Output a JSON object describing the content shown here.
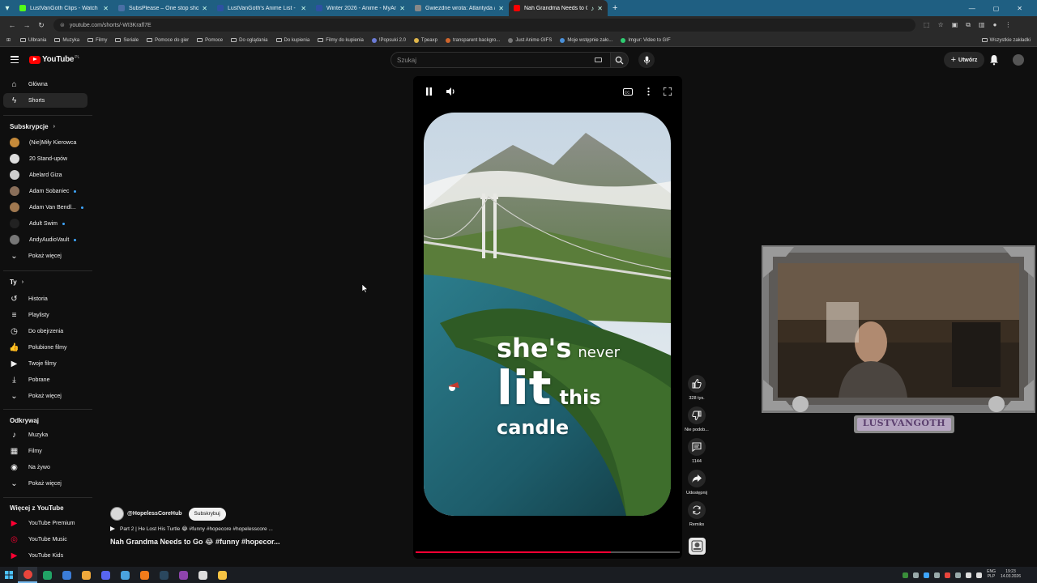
{
  "browser": {
    "tabs": [
      {
        "title": "LustVanGoth Clips - Watch Live",
        "favicon_color": "#53fc18",
        "active": false
      },
      {
        "title": "SubsPlease – One stop shop fo",
        "favicon_color": "#4a6fa5",
        "active": false
      },
      {
        "title": "LustVanGoth's Anime List - My",
        "favicon_color": "#2e51a2",
        "active": false
      },
      {
        "title": "Winter 2026 - Anime - MyAnim",
        "favicon_color": "#2e51a2",
        "active": false
      },
      {
        "title": "Gwiezdne wrota: Atlantyda / St",
        "favicon_color": "#888888",
        "active": false
      },
      {
        "title": "Nah Grandma Needs to Go",
        "favicon_color": "#ff0000",
        "active": true
      }
    ],
    "url": "youtube.com/shorts/-WI3Krafl7E",
    "bookmarks": [
      {
        "label": "Ulbrania",
        "type": "folder"
      },
      {
        "label": "Muzyka",
        "type": "folder"
      },
      {
        "label": "Filmy",
        "type": "folder"
      },
      {
        "label": "Seriale",
        "type": "folder"
      },
      {
        "label": "Pomoce do gier",
        "type": "folder"
      },
      {
        "label": "Pomoce",
        "type": "folder"
      },
      {
        "label": "Do oglądania",
        "type": "folder"
      },
      {
        "label": "Do kupienia",
        "type": "folder"
      },
      {
        "label": "Filmy do kupienia",
        "type": "folder"
      },
      {
        "label": "!Popsuki 2.0",
        "type": "link",
        "color": "#6b7bd6"
      },
      {
        "label": "Tpeaxp",
        "type": "link",
        "color": "#e0b64a"
      },
      {
        "label": "transparent backgro...",
        "type": "link",
        "color": "#d0662d"
      },
      {
        "label": "Just Anime GIFS",
        "type": "link",
        "color": "#777777"
      },
      {
        "label": "Moje wstępnie zało...",
        "type": "link",
        "color": "#4a90d9"
      },
      {
        "label": "Imgur: Video to GIF",
        "type": "link",
        "color": "#2ecc71"
      }
    ],
    "bookmarks_all": "Wszystkie zakładki"
  },
  "header": {
    "logo": "YouTube",
    "logo_country": "PL",
    "search_placeholder": "Szukaj",
    "create_label": "Utwórz"
  },
  "sidebar": {
    "main": [
      {
        "label": "Główna",
        "icon": "home-icon",
        "active": false
      },
      {
        "label": "Shorts",
        "icon": "shorts-icon",
        "active": true
      }
    ],
    "subs_heading": "Subskrypcje",
    "subscriptions": [
      {
        "label": "(Nie)Miły Kierowca",
        "color": "#c58a3a",
        "live": false
      },
      {
        "label": "20 Stand-upów",
        "color": "#dddddd",
        "live": false
      },
      {
        "label": "Abelard Giza",
        "color": "#cccccc",
        "live": false
      },
      {
        "label": "Adam Sobaniec",
        "color": "#8a6f5a",
        "live": true
      },
      {
        "label": "Adam Van Bendl...",
        "color": "#a07850",
        "live": true
      },
      {
        "label": "Adult Swim",
        "color": "#222222",
        "live": true
      },
      {
        "label": "AndyAudioVault",
        "color": "#777777",
        "live": true
      }
    ],
    "subs_more": "Pokaż więcej",
    "you_heading": "Ty",
    "you_items": [
      {
        "label": "Historia",
        "icon": "history-icon"
      },
      {
        "label": "Playlisty",
        "icon": "playlists-icon"
      },
      {
        "label": "Do obejrzenia",
        "icon": "watch-later-icon"
      },
      {
        "label": "Polubione filmy",
        "icon": "liked-videos-icon"
      },
      {
        "label": "Twoje filmy",
        "icon": "your-videos-icon"
      },
      {
        "label": "Pobrane",
        "icon": "downloads-icon"
      }
    ],
    "you_more": "Pokaż więcej",
    "explore_heading": "Odkrywaj",
    "explore_items": [
      {
        "label": "Muzyka",
        "icon": "music-icon"
      },
      {
        "label": "Filmy",
        "icon": "movies-icon"
      },
      {
        "label": "Na żywo",
        "icon": "live-icon"
      }
    ],
    "explore_more": "Pokaż więcej",
    "more_heading": "Więcej z YouTube",
    "more_items": [
      {
        "label": "YouTube Premium",
        "icon": "yt-premium-icon"
      },
      {
        "label": "YouTube Music",
        "icon": "yt-music-icon"
      },
      {
        "label": "YouTube Kids",
        "icon": "yt-kids-icon"
      }
    ]
  },
  "short": {
    "caption": {
      "line1_big": "she's",
      "line1_small": "never",
      "line2_big": "lit",
      "line2_small": "this",
      "line3": "candle"
    },
    "progress": 0.74,
    "channel": "@HopelessCoreHub",
    "subscribe_label": "Subskrybuj",
    "playlist_text": "Part 2 | He Lost His Turtle 😂 #funny #hopecore #hopelesscore ...",
    "title": "Nah Grandma Needs to Go 😂 #funny #hopecor...",
    "actions": [
      {
        "label": "328 tys.",
        "icon": "like-icon"
      },
      {
        "label": "Nie podob...",
        "icon": "dislike-icon"
      },
      {
        "label": "1144",
        "icon": "comment-icon"
      },
      {
        "label": "Udostępnij",
        "icon": "share-icon"
      },
      {
        "label": "Remiks",
        "icon": "remix-icon"
      }
    ]
  },
  "webcam": {
    "nameplate": "LUSTVANGOTH"
  },
  "taskbar": {
    "lang1": "ENG",
    "lang2": "PLP",
    "time": "19:23",
    "date": "14.03.2026",
    "apps": [
      {
        "name": "chrome",
        "color": "#e8453c"
      },
      {
        "name": "app-green",
        "color": "#21a366"
      },
      {
        "name": "app-globe",
        "color": "#3b7dd8"
      },
      {
        "name": "app-tri",
        "color": "#f0a93b"
      },
      {
        "name": "app-discord",
        "color": "#5865f2"
      },
      {
        "name": "app-box",
        "color": "#4aa3df"
      },
      {
        "name": "app-vlc",
        "color": "#f07c1b"
      },
      {
        "name": "app-steam",
        "color": "#2a475e"
      },
      {
        "name": "app-purple",
        "color": "#8e44ad"
      },
      {
        "name": "app-obs",
        "color": "#dddddd"
      },
      {
        "name": "app-files",
        "color": "#f6c343"
      }
    ]
  }
}
